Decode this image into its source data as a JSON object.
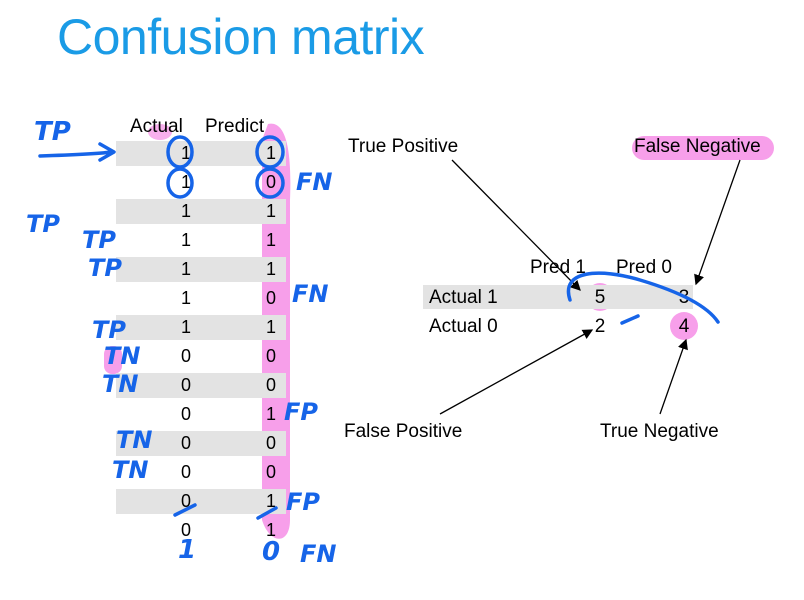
{
  "title": "Confusion matrix",
  "table": {
    "header_actual": "Actual",
    "header_predict": "Predict",
    "rows": [
      {
        "actual": "1",
        "predict": "1"
      },
      {
        "actual": "1",
        "predict": "0"
      },
      {
        "actual": "1",
        "predict": "1"
      },
      {
        "actual": "1",
        "predict": "1"
      },
      {
        "actual": "1",
        "predict": "1"
      },
      {
        "actual": "1",
        "predict": "0"
      },
      {
        "actual": "1",
        "predict": "1"
      },
      {
        "actual": "0",
        "predict": "0"
      },
      {
        "actual": "0",
        "predict": "0"
      },
      {
        "actual": "0",
        "predict": "1"
      },
      {
        "actual": "0",
        "predict": "0"
      },
      {
        "actual": "0",
        "predict": "0"
      },
      {
        "actual": "0",
        "predict": "1"
      },
      {
        "actual": "0",
        "predict": "1"
      }
    ]
  },
  "matrix": {
    "col_headers": [
      "Pred 1",
      "Pred 0"
    ],
    "row_headers": [
      "Actual 1",
      "Actual 0"
    ],
    "values": [
      [
        "5",
        "3"
      ],
      [
        "2",
        "4"
      ]
    ]
  },
  "callouts": {
    "true_positive": "True Positive",
    "false_negative": "False Negative",
    "false_positive": "False Positive",
    "true_negative": "True Negative"
  },
  "handwriting": {
    "tp": "TP",
    "tn": "TN",
    "fn": "FN",
    "fp": "FP",
    "bottom_actual": "1",
    "bottom_predict": "0"
  },
  "colors": {
    "title": "#1a9be6",
    "ink_blue": "#1664e8",
    "highlight_pink": "#f050d8",
    "row_band": "#e3e3e3"
  }
}
